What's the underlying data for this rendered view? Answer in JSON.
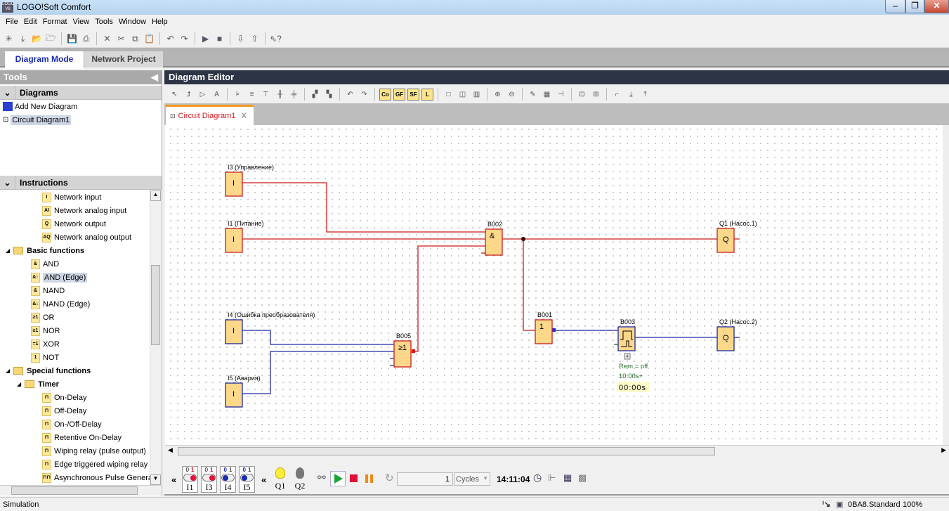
{
  "app": {
    "title": "LOGO!Soft Comfort",
    "logo_text": "LOGO V8"
  },
  "window_controls": [
    "minimize",
    "restore",
    "close"
  ],
  "menu": [
    "File",
    "Edit",
    "Format",
    "View",
    "Tools",
    "Window",
    "Help"
  ],
  "toolbar_icons": [
    "new-icon",
    "download-icon",
    "open-icon",
    "open-folder-icon",
    "|",
    "save-icon",
    "print-icon",
    "|",
    "delete-icon",
    "cut-icon",
    "copy-icon",
    "paste-icon",
    "|",
    "undo-icon",
    "redo-icon",
    "|",
    "start-sim-icon",
    "stop-sim-icon",
    "|",
    "pc-to-logo-icon",
    "logo-to-pc-icon",
    "|",
    "context-help-icon"
  ],
  "mode_tabs": [
    {
      "label": "Diagram Mode",
      "active": true
    },
    {
      "label": "Network Project",
      "active": false
    }
  ],
  "tools_panel": {
    "title": "Tools",
    "diagrams": {
      "title": "Diagrams",
      "items": [
        {
          "label": "Add New Diagram"
        },
        {
          "label": "Circuit Diagram1",
          "selected": true
        }
      ]
    },
    "instructions": {
      "title": "Instructions",
      "tree": [
        {
          "label": "Network input",
          "icon": "I",
          "level": 3
        },
        {
          "label": "Network analog input",
          "icon": "AI",
          "level": 3
        },
        {
          "label": "Network output",
          "icon": "Q",
          "level": 3
        },
        {
          "label": "Network analog output",
          "icon": "AQ",
          "level": 3
        },
        {
          "label": "Basic functions",
          "folder": true,
          "level": 1
        },
        {
          "label": "AND",
          "icon": "&",
          "level": 2
        },
        {
          "label": "AND (Edge)",
          "icon": "&↑",
          "level": 2,
          "selected": true
        },
        {
          "label": "NAND",
          "icon": "&",
          "level": 2
        },
        {
          "label": "NAND (Edge)",
          "icon": "&↓",
          "level": 2
        },
        {
          "label": "OR",
          "icon": "≥1",
          "level": 2
        },
        {
          "label": "NOR",
          "icon": "≥1",
          "level": 2
        },
        {
          "label": "XOR",
          "icon": "=1",
          "level": 2
        },
        {
          "label": "NOT",
          "icon": "1",
          "level": 2
        },
        {
          "label": "Special functions",
          "folder": true,
          "level": 1
        },
        {
          "label": "Timer",
          "folder": true,
          "level": 2
        },
        {
          "label": "On-Delay",
          "icon": "⊓",
          "level": 3
        },
        {
          "label": "Off-Delay",
          "icon": "⊓",
          "level": 3
        },
        {
          "label": "On-/Off-Delay",
          "icon": "⊓",
          "level": 3
        },
        {
          "label": "Retentive On-Delay",
          "icon": "⊓",
          "level": 3
        },
        {
          "label": "Wiping relay (pulse output)",
          "icon": "⊓",
          "level": 3
        },
        {
          "label": "Edge triggered wiping relay",
          "icon": "⊓",
          "level": 3
        },
        {
          "label": "Asynchronous Pulse Genera",
          "icon": "⊓⊓",
          "level": 3
        }
      ]
    }
  },
  "editor": {
    "title": "Diagram Editor",
    "toolbar": [
      "select-icon",
      "connect-icon",
      "constants-icon",
      "text-icon",
      "|",
      "align-left-icon",
      "align-right-icon",
      "align-top-icon",
      "align-center-v-icon",
      "align-center-h-icon",
      "|",
      "group-icon",
      "ungroup-icon",
      "|",
      "undo-icon",
      "redo-icon",
      "|",
      "Co",
      "GF",
      "SF",
      "L",
      "|",
      "single-view-icon",
      "split-view-icon",
      "triple-view-icon",
      "|",
      "zoom-in-icon",
      "zoom-out-icon",
      "|",
      "pencil-icon",
      "block-numbering-icon",
      "cut-connection-icon",
      "|",
      "simulation-icon",
      "online-test-icon",
      "|",
      "route-icon",
      "move-down-icon",
      "move-up-icon"
    ],
    "tab": {
      "label": "Circuit Diagram1",
      "close": "X"
    }
  },
  "diagram": {
    "blocks": {
      "I3": {
        "label": "I3 (Управление)",
        "symbol": "I"
      },
      "I1": {
        "label": "I1 (Питание)",
        "symbol": "I"
      },
      "I4": {
        "label": "I4 (Ошибка преобразователя)",
        "symbol": "I"
      },
      "I5": {
        "label": "I5 (Авария)",
        "symbol": "I"
      },
      "B002": {
        "label": "B002",
        "symbol": "&"
      },
      "B005": {
        "label": "B005",
        "symbol": "≥1"
      },
      "B001": {
        "label": "B001",
        "symbol": "1"
      },
      "B003": {
        "label": "B003",
        "symbol": "pulse"
      },
      "Q1": {
        "label": "Q1 (Насос.1)",
        "symbol": "Q"
      },
      "Q2": {
        "label": "Q2 (Насос.2)",
        "symbol": "Q"
      }
    },
    "b003_params": {
      "rem": "Rem = off",
      "time": "10:00s+",
      "current": "00:00s"
    },
    "colors": {
      "signal_high": "#cc1b1b",
      "signal_low": "#1c2aa0",
      "block_fill": "#fdd88a"
    }
  },
  "simulation": {
    "inputs": [
      {
        "name": "I1",
        "state": 1
      },
      {
        "name": "I3",
        "state": 1
      },
      {
        "name": "I4",
        "state": 0
      },
      {
        "name": "I5",
        "state": 0
      }
    ],
    "outputs": [
      {
        "name": "Q1",
        "on": true
      },
      {
        "name": "Q2",
        "on": false
      }
    ],
    "cycles_value": "1",
    "cycles_unit": "Cycles",
    "time": "14:11:04",
    "collapse": "«",
    "zero": "0",
    "one": "1"
  },
  "status": {
    "left": "Simulation",
    "device": "0BA8.Standard",
    "zoom": "100%"
  }
}
